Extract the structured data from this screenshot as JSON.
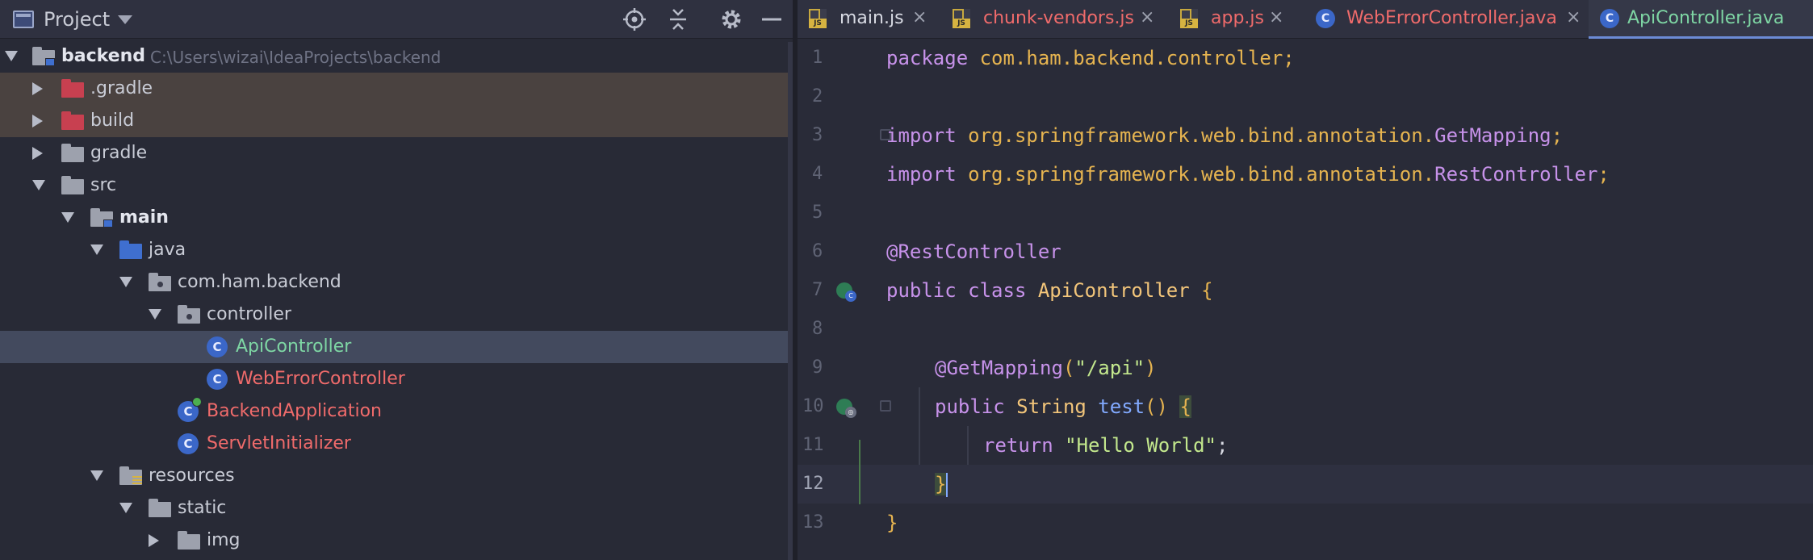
{
  "project": {
    "title": "Project",
    "header_icons": [
      "locate-icon",
      "collapse-all-icon",
      "gear-icon",
      "minimize-icon"
    ],
    "tree": [
      {
        "label": "backend",
        "path": "C:\\Users\\wizai\\IdeaProjects\\backend",
        "icon": "module-folder-icon",
        "expanded": true,
        "depth": 0
      },
      {
        "label": ".gradle",
        "icon": "excluded-folder-icon",
        "expanded": false,
        "depth": 1
      },
      {
        "label": "build",
        "icon": "excluded-folder-icon",
        "expanded": false,
        "depth": 1
      },
      {
        "label": "gradle",
        "icon": "folder-icon",
        "expanded": false,
        "depth": 1
      },
      {
        "label": "src",
        "icon": "folder-icon",
        "expanded": true,
        "depth": 1
      },
      {
        "label": "main",
        "icon": "module-folder-icon",
        "expanded": true,
        "depth": 2
      },
      {
        "label": "java",
        "icon": "source-folder-icon",
        "expanded": true,
        "depth": 3
      },
      {
        "label": "com.ham.backend",
        "icon": "package-icon",
        "expanded": true,
        "depth": 4
      },
      {
        "label": "controller",
        "icon": "package-icon",
        "expanded": true,
        "depth": 5
      },
      {
        "label": "ApiController",
        "icon": "class-icon",
        "depth": 6
      },
      {
        "label": "WebErrorController",
        "icon": "class-icon",
        "depth": 6
      },
      {
        "label": "BackendApplication",
        "icon": "spring-class-icon",
        "depth": 5
      },
      {
        "label": "ServletInitializer",
        "icon": "class-icon",
        "depth": 5
      },
      {
        "label": "resources",
        "icon": "resources-folder-icon",
        "expanded": true,
        "depth": 3
      },
      {
        "label": "static",
        "icon": "folder-icon",
        "expanded": true,
        "depth": 4
      },
      {
        "label": "img",
        "icon": "folder-icon",
        "expanded": false,
        "depth": 5
      }
    ]
  },
  "tabs": [
    {
      "label": "main.js",
      "icon": "js-file-icon",
      "color": "#d8dae3"
    },
    {
      "label": "chunk-vendors.js",
      "icon": "js-file-icon",
      "color": "#f06b6b"
    },
    {
      "label": "app.js",
      "icon": "js-file-icon",
      "color": "#f06b6b"
    },
    {
      "label": "WebErrorController.java",
      "icon": "class-icon",
      "color": "#f06b6b"
    },
    {
      "label": "ApiController.java",
      "icon": "class-icon",
      "color": "#7ed6a4",
      "active": true
    }
  ],
  "editor": {
    "line_numbers": [
      "1",
      "2",
      "3",
      "4",
      "5",
      "6",
      "7",
      "8",
      "9",
      "10",
      "11",
      "12",
      "13"
    ],
    "lines": {
      "l1_kw": "package",
      "l1_rest": " com.ham.backend.controller;",
      "l3_kw": "import",
      "l3_pkg": " org.springframework.web.bind.annotation.",
      "l3_cls": "GetMapping",
      "l3_end": ";",
      "l4_kw": "import",
      "l4_pkg": " org.springframework.web.bind.annotation.",
      "l4_cls": "RestController",
      "l4_end": ";",
      "l6_ann": "@RestController",
      "l7_kw": "public class",
      "l7_cls": " ApiController",
      "l7_brace": " {",
      "l9_ann": "@GetMapping",
      "l9_open": "(",
      "l9_str": "\"/api\"",
      "l9_close": ")",
      "l10_kw": "public",
      "l10_type": " String",
      "l10_fn": " test",
      "l10_paren": "()",
      "l10_brace": "{",
      "l11_kw": "return",
      "l11_str": " \"Hello World\"",
      "l11_end": ";",
      "l12_brace": "}",
      "l13_brace": "}"
    },
    "current_line": "12"
  },
  "colors": {
    "selection": "#434a5e",
    "excluded_highlight": "#4a4240",
    "accent": "#6c8bd6"
  }
}
